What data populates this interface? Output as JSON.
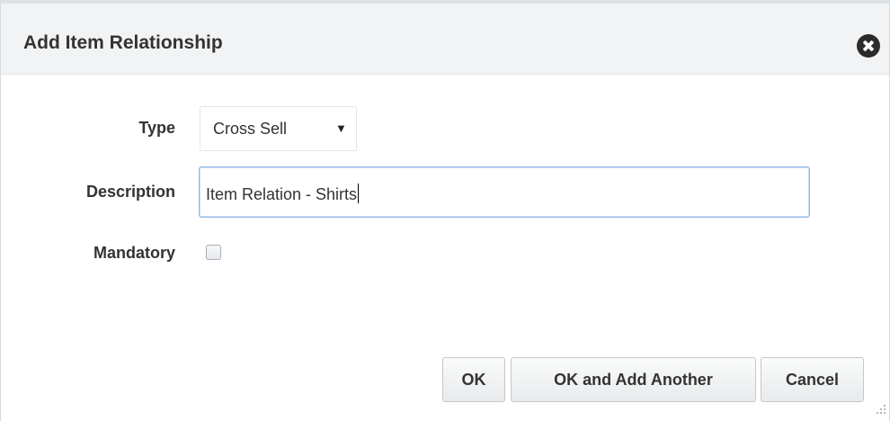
{
  "dialog": {
    "title": "Add Item Relationship",
    "close_icon": "close-circle-icon"
  },
  "form": {
    "type_label": "Type",
    "type_value": "Cross Sell",
    "type_arrow": "▼",
    "description_label": "Description",
    "description_value": "Item Relation - Shirts",
    "mandatory_label": "Mandatory",
    "mandatory_checked": false
  },
  "buttons": {
    "ok": "OK",
    "ok_add_another": "OK and Add Another",
    "cancel": "Cancel"
  },
  "colors": {
    "header_bg": "#f2f3f4",
    "focus_border": "#95b8e7",
    "text": "#333333"
  }
}
